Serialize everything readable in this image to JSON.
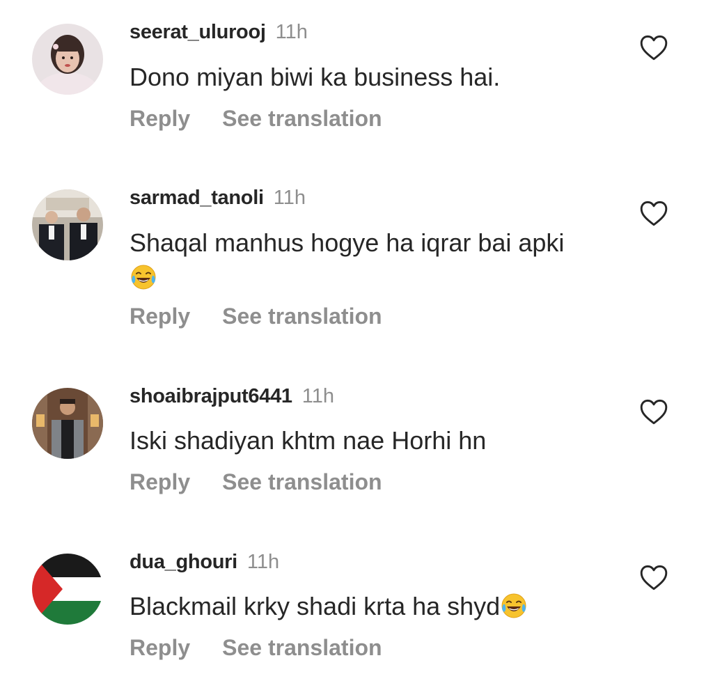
{
  "comments": [
    {
      "username": "seerat_ulurooj",
      "time": "11h",
      "text": "Dono miyan biwi ka business hai.",
      "emoji": "",
      "reply_label": "Reply",
      "translate_label": "See translation",
      "like_icon": "heart-outline-icon"
    },
    {
      "username": "sarmad_tanoli",
      "time": "11h",
      "text": "Shaqal manhus hogye ha iqrar bai apki",
      "emoji": "😂",
      "reply_label": "Reply",
      "translate_label": "See translation",
      "like_icon": "heart-outline-icon"
    },
    {
      "username": "shoaibrajput6441",
      "time": "11h",
      "text": "Iski shadiyan khtm nae Horhi hn",
      "emoji": "",
      "reply_label": "Reply",
      "translate_label": "See translation",
      "like_icon": "heart-outline-icon"
    },
    {
      "username": "dua_ghouri",
      "time": "11h",
      "text": "Blackmail krky shadi krta ha shyd",
      "emoji": "😂",
      "reply_label": "Reply",
      "translate_label": "See translation",
      "like_icon": "heart-outline-icon"
    }
  ],
  "colors": {
    "primary_text": "#262626",
    "secondary_text": "#8e8e8e",
    "background": "#ffffff"
  }
}
